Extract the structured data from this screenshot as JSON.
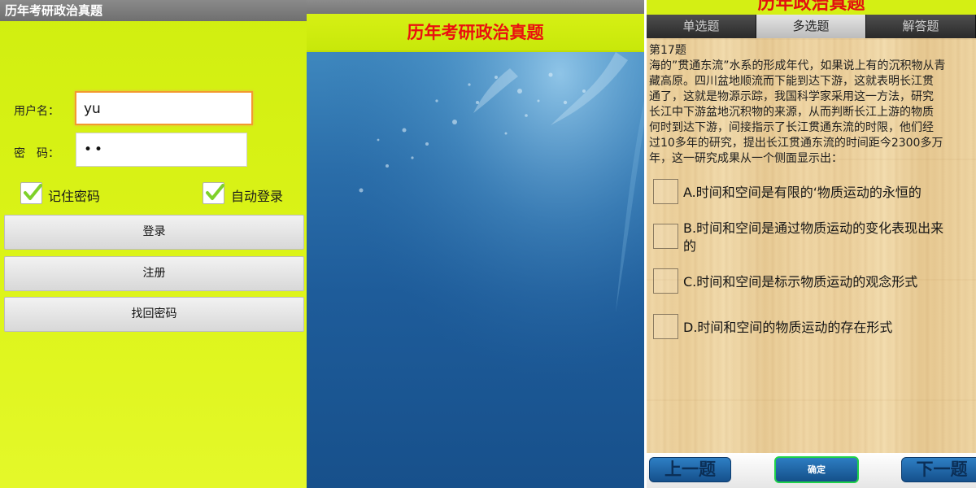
{
  "login_screen": {
    "title": "历年考研政治真题",
    "username_label": "用户名：",
    "username_value": "yu",
    "password_label": "密　码：",
    "password_value": "••",
    "remember_label": "记住密码",
    "remember_checked": true,
    "auto_login_label": "自动登录",
    "auto_login_checked": true,
    "login_button": "登录",
    "register_button": "注册",
    "recover_button": "找回密码",
    "accent_color": "#d4ef14"
  },
  "splash_screen": {
    "header_title": "历年考研政治真题",
    "header_color": "#ea1010"
  },
  "question_screen": {
    "partial_title": "历年政治真题",
    "tabs": [
      {
        "label": "单选题",
        "active": false
      },
      {
        "label": "多选题",
        "active": true
      },
      {
        "label": "解答题",
        "active": false
      }
    ],
    "question_number": "第17题",
    "question_lines": [
      "海的”贯通东流”水系的形成年代，如果说上有的沉积物从青",
      "藏高原。四川盆地顺流而下能到达下游，这就表明长江贯",
      "通了，这就是物源示踪，我国科学家采用这一方法，研究",
      "长江中下游盆地沉积物的来源，从而判断长江上游的物质",
      "何时到达下游，间接指示了长江贯通东流的时限，他们经",
      "过10多年的研究，提出长江贯通东流的时间距今2300多万",
      "年，这一研究成果从一个侧面显示出："
    ],
    "options": [
      {
        "lines": [
          "A.时间和空间是有限的‘物质运动的永恒的"
        ]
      },
      {
        "lines": [
          "B.时间和空间是通过物质运动的变化表现出来",
          "的"
        ]
      },
      {
        "lines": [
          "C.时间和空间是标示物质运动的观念形式"
        ]
      },
      {
        "lines": [
          "D.时间和空间的物质运动的存在形式"
        ]
      }
    ],
    "prev_button": "上一题",
    "confirm_button": "确定",
    "next_button": "下一题"
  }
}
